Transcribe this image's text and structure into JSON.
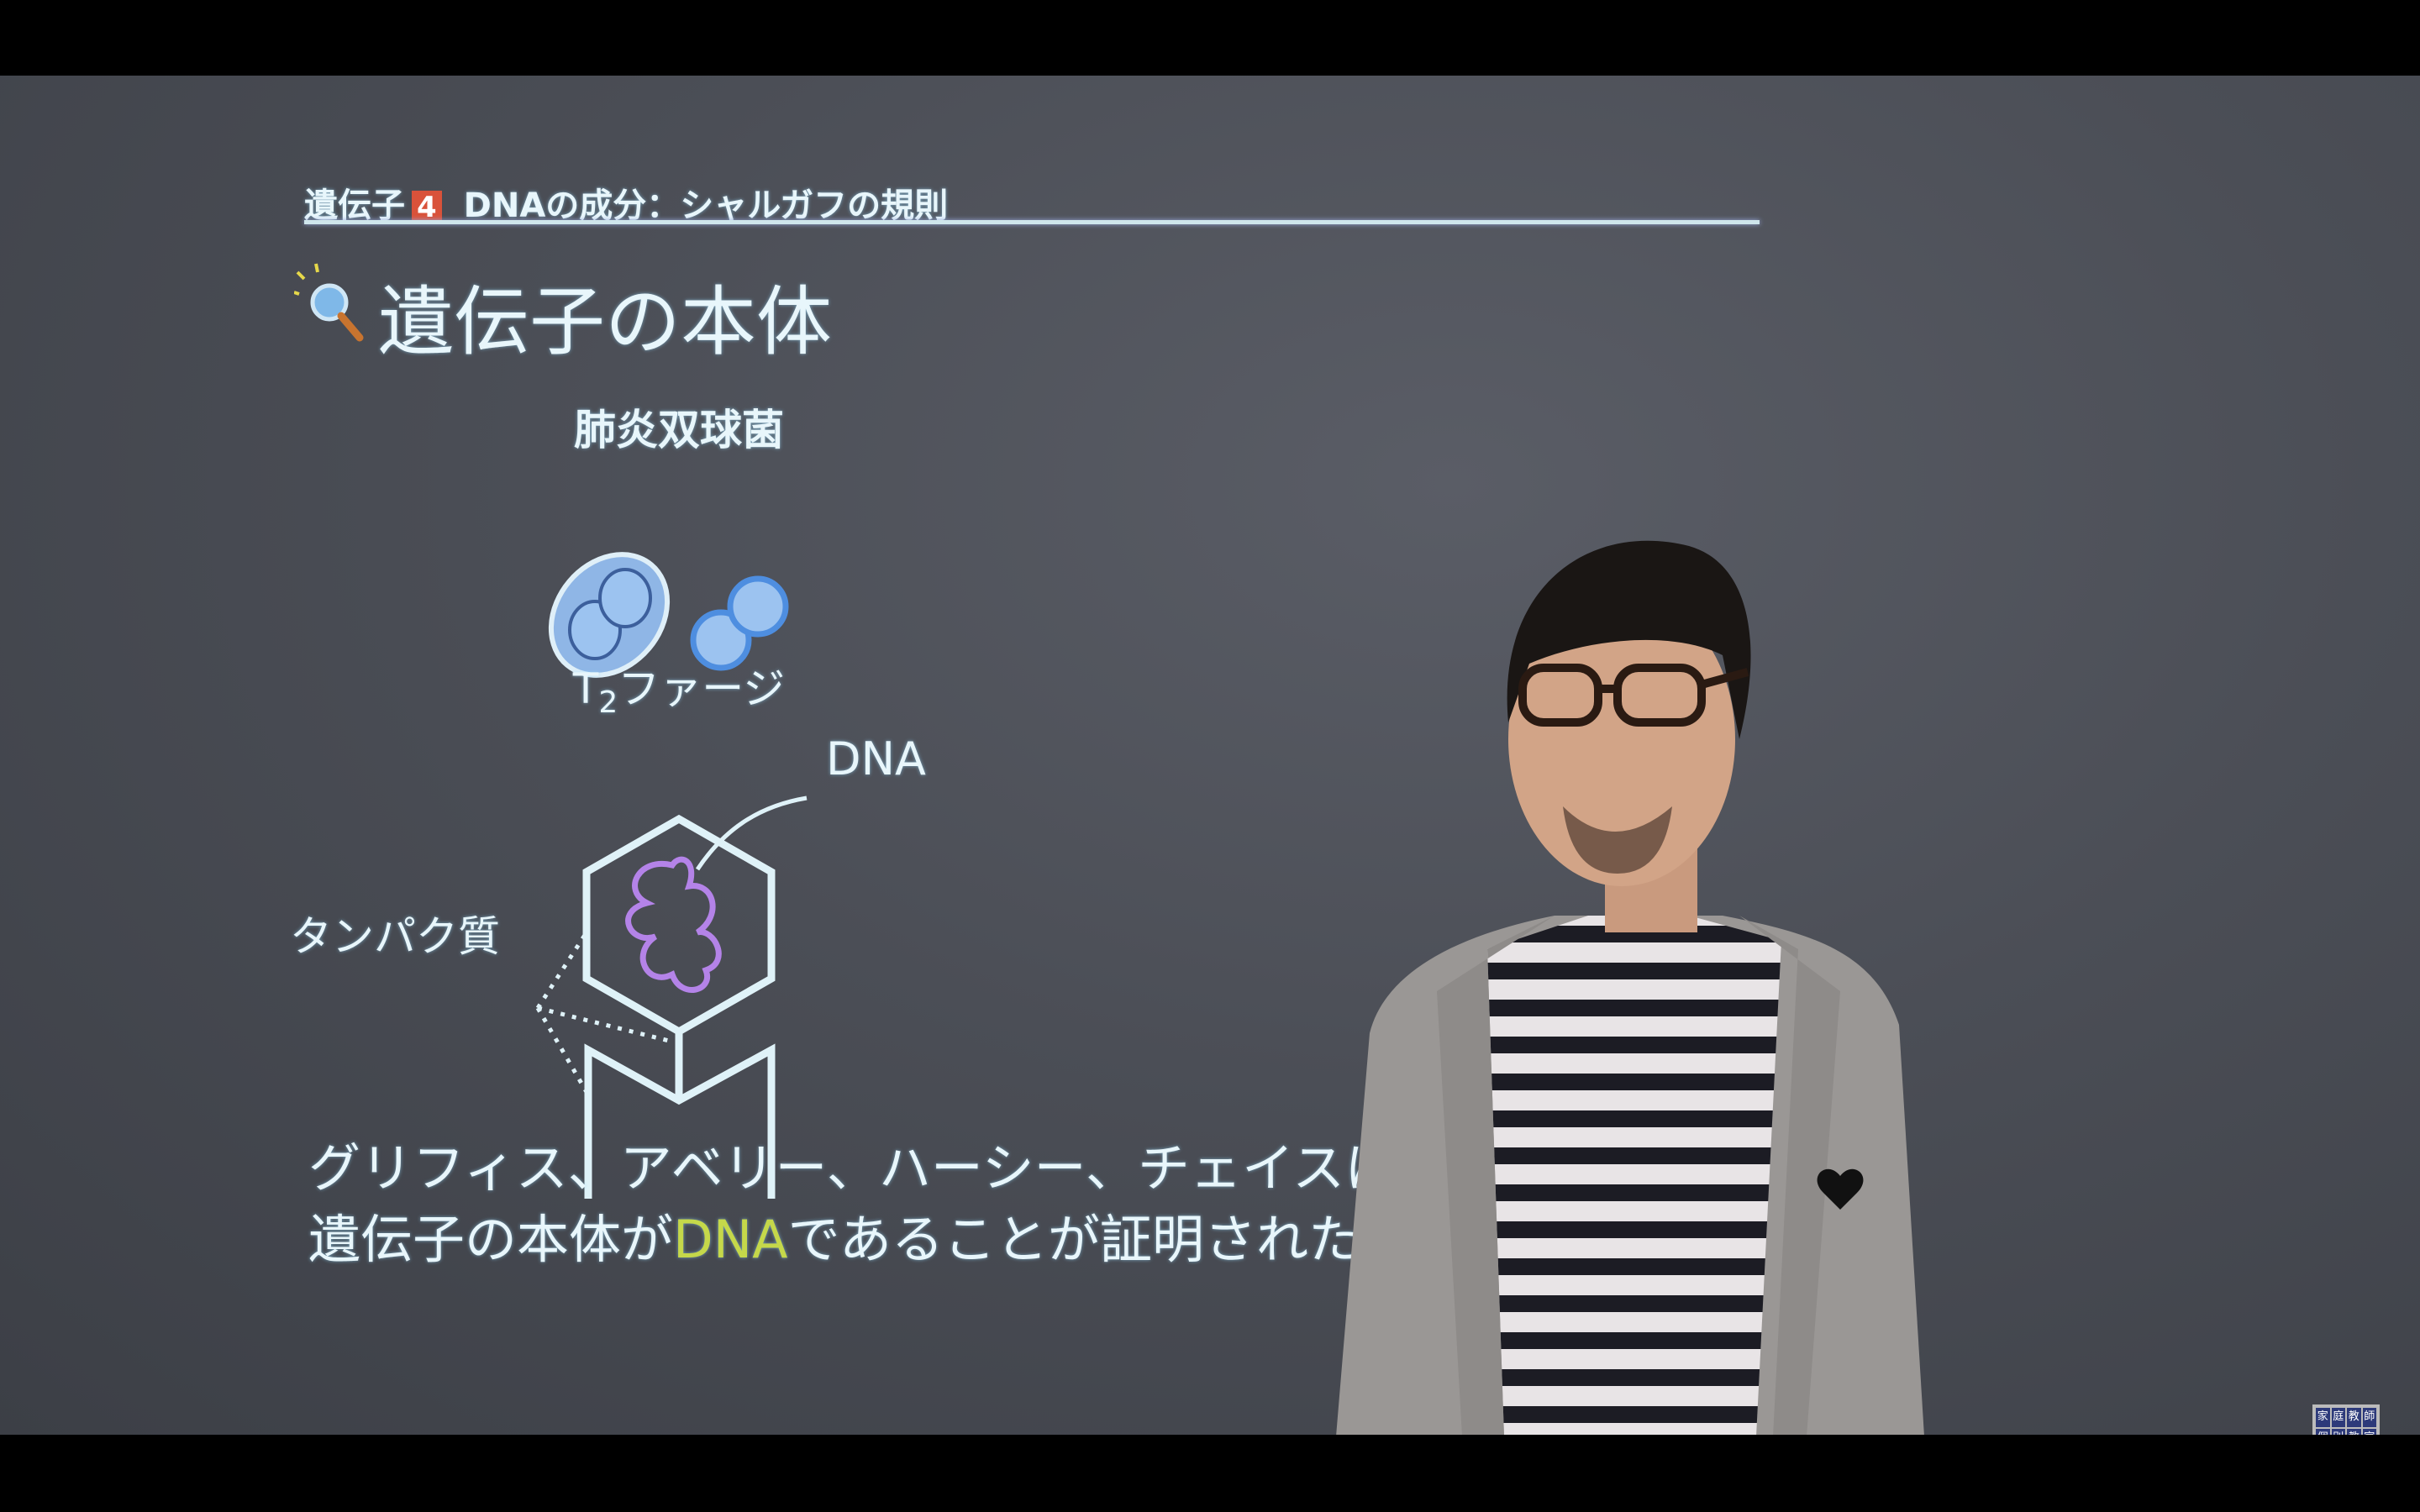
{
  "slide": {
    "header_prefix": "遺伝子",
    "header_number": "4",
    "header_title": "DNAの成分：シャルガフの規則",
    "title": "遺伝子の本体",
    "title_icon": "magnifier-icon",
    "pneumococcus_label": "肺炎双球菌",
    "phage_label_main": "T",
    "phage_label_sub": "2",
    "phage_label_rest": "ファージ",
    "dna_label": "DNA",
    "protein_label": "タンパク質",
    "line1": "グリフィス、アベリー、ハーシー、チェイスによ",
    "line2_pre": "遺伝子の本体が",
    "line2_hl": "DNA",
    "line2_post": "であることが証明された",
    "highlight_color": "#c5d84a",
    "number_badge_color": "#d9523a"
  },
  "logo": [
    "家",
    "庭",
    "教",
    "師",
    "個",
    "別",
    "教",
    "室",
    "の",
    "ト",
    "ラ",
    "イ"
  ]
}
